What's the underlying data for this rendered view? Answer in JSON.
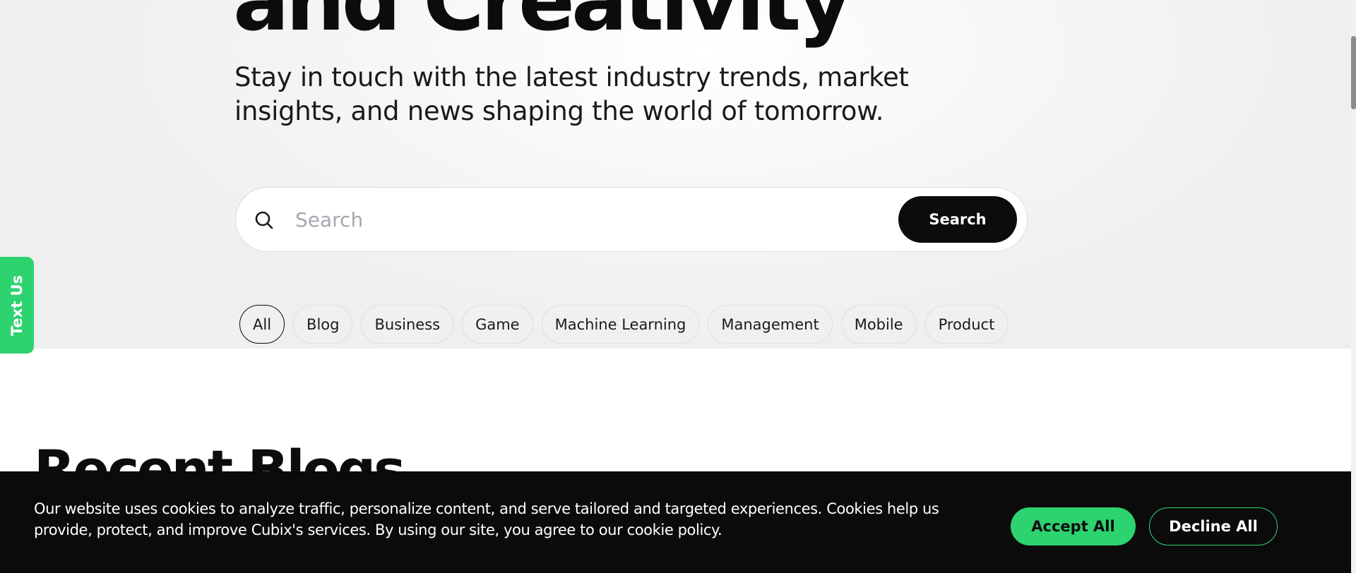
{
  "hero": {
    "title": "and Creativity",
    "subtitle": "Stay in touch with the latest industry trends, market insights, and news shaping the world of tomorrow.",
    "search": {
      "placeholder": "Search",
      "value": "",
      "button_label": "Search",
      "icon": "search-icon"
    },
    "filters": [
      {
        "label": "All",
        "active": true
      },
      {
        "label": "Blog",
        "active": false
      },
      {
        "label": "Business",
        "active": false
      },
      {
        "label": "Game",
        "active": false
      },
      {
        "label": "Machine Learning",
        "active": false
      },
      {
        "label": "Management",
        "active": false
      },
      {
        "label": "Mobile",
        "active": false
      },
      {
        "label": "Product",
        "active": false
      }
    ]
  },
  "side_tab": {
    "label": "Text Us"
  },
  "section": {
    "title": "Recent Blogs"
  },
  "cookie_banner": {
    "text": "Our website uses cookies to analyze traffic, personalize content, and serve tailored and targeted experiences. Cookies help us provide, protect, and improve Cubix's services. By using our site, you agree to our cookie policy.",
    "accept_label": "Accept All",
    "decline_label": "Decline All"
  },
  "colors": {
    "accent_green": "#2dd36f",
    "dark": "#0c0c0c",
    "hero_bg": "#f2f2f2"
  }
}
